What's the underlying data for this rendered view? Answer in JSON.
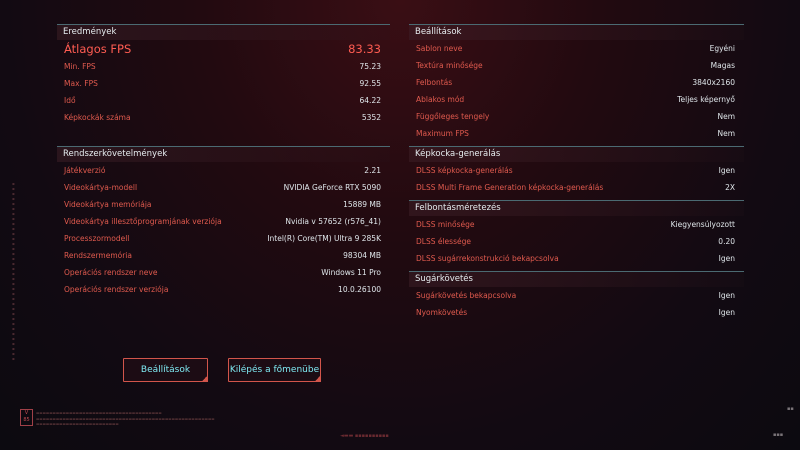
{
  "results": {
    "title": "Eredmények",
    "rows": [
      {
        "label": "Átlagos FPS",
        "value": "83.33"
      },
      {
        "label": "Min. FPS",
        "value": "75.23"
      },
      {
        "label": "Max. FPS",
        "value": "92.55"
      },
      {
        "label": "Idő",
        "value": "64.22"
      },
      {
        "label": "Képkockák száma",
        "value": "5352"
      }
    ]
  },
  "system": {
    "title": "Rendszerkövetelmények",
    "rows": [
      {
        "label": "Játékverzió",
        "value": "2.21"
      },
      {
        "label": "Videokártya-modell",
        "value": "NVIDIA GeForce RTX 5090"
      },
      {
        "label": "Videokártya memóriája",
        "value": "15889 MB"
      },
      {
        "label": "Videokártya illesztőprogramjának verziója",
        "value": "Nvidia v 57652 (r576_41)"
      },
      {
        "label": "Processzormodell",
        "value": "Intel(R) Core(TM) Ultra 9 285K"
      },
      {
        "label": "Rendszermemória",
        "value": "98304 MB"
      },
      {
        "label": "Operációs rendszer neve",
        "value": "Windows 11 Pro"
      },
      {
        "label": "Operációs rendszer verziója",
        "value": "10.0.26100"
      }
    ]
  },
  "settings": {
    "title": "Beállítások",
    "rows": [
      {
        "label": "Sablon neve",
        "value": "Egyéni"
      },
      {
        "label": "Textúra minősége",
        "value": "Magas"
      },
      {
        "label": "Felbontás",
        "value": "3840x2160"
      },
      {
        "label": "Ablakos mód",
        "value": "Teljes képernyő"
      },
      {
        "label": "Függőleges tengely",
        "value": "Nem"
      },
      {
        "label": "Maximum FPS",
        "value": "Nem"
      }
    ]
  },
  "frame_gen": {
    "title": "Képkocka-generálás",
    "rows": [
      {
        "label": "DLSS képkocka-generálás",
        "value": "Igen"
      },
      {
        "label": "DLSS Multi Frame Generation képkocka-generálás",
        "value": "2X"
      }
    ]
  },
  "upscaling": {
    "title": "Felbontásméretezés",
    "rows": [
      {
        "label": "DLSS minősége",
        "value": "Kiegyensúlyozott"
      },
      {
        "label": "DLSS élessége",
        "value": "0.20"
      },
      {
        "label": "DLSS sugárrekonstrukció bekapcsolva",
        "value": "Igen"
      }
    ]
  },
  "raytracing": {
    "title": "Sugárkövetés",
    "rows": [
      {
        "label": "Sugárkövetés bekapcsolva",
        "value": "Igen"
      },
      {
        "label": "Nyomkövetés",
        "value": "Igen"
      }
    ]
  },
  "buttons": {
    "settings": "Beállítások",
    "exit": "Kilépés a főmenübe"
  },
  "colors": {
    "label": "#e05a4e",
    "value": "#dfe6ea",
    "accent": "#ff5c52",
    "button_text": "#7fe9f2",
    "border": "#4b6a72"
  }
}
